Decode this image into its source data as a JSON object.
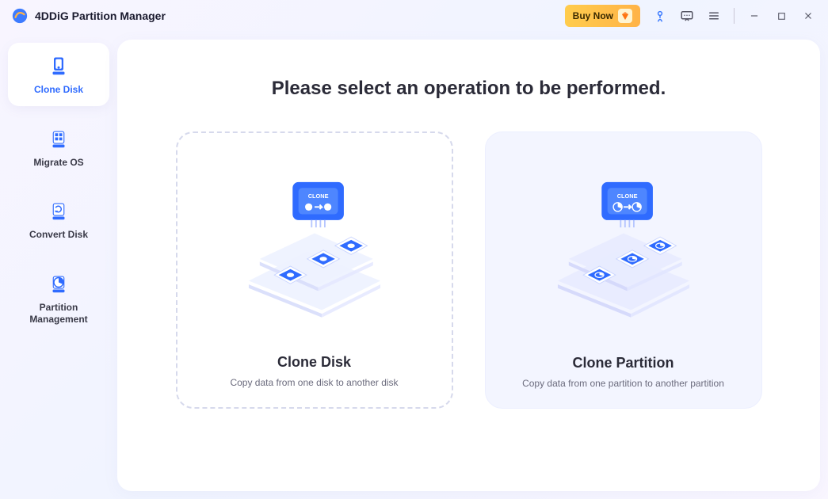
{
  "app": {
    "title": "4DDiG Partition Manager"
  },
  "header": {
    "buy_label": "Buy Now"
  },
  "sidebar": {
    "items": [
      {
        "label": "Clone Disk"
      },
      {
        "label": "Migrate OS"
      },
      {
        "label": "Convert Disk"
      },
      {
        "label": "Partition Management"
      }
    ]
  },
  "main": {
    "title": "Please select an operation to be performed.",
    "cards": [
      {
        "title": "Clone Disk",
        "desc": "Copy data from one disk to another disk"
      },
      {
        "title": "Clone Partition",
        "desc": "Copy data from one partition to another partition"
      }
    ]
  }
}
